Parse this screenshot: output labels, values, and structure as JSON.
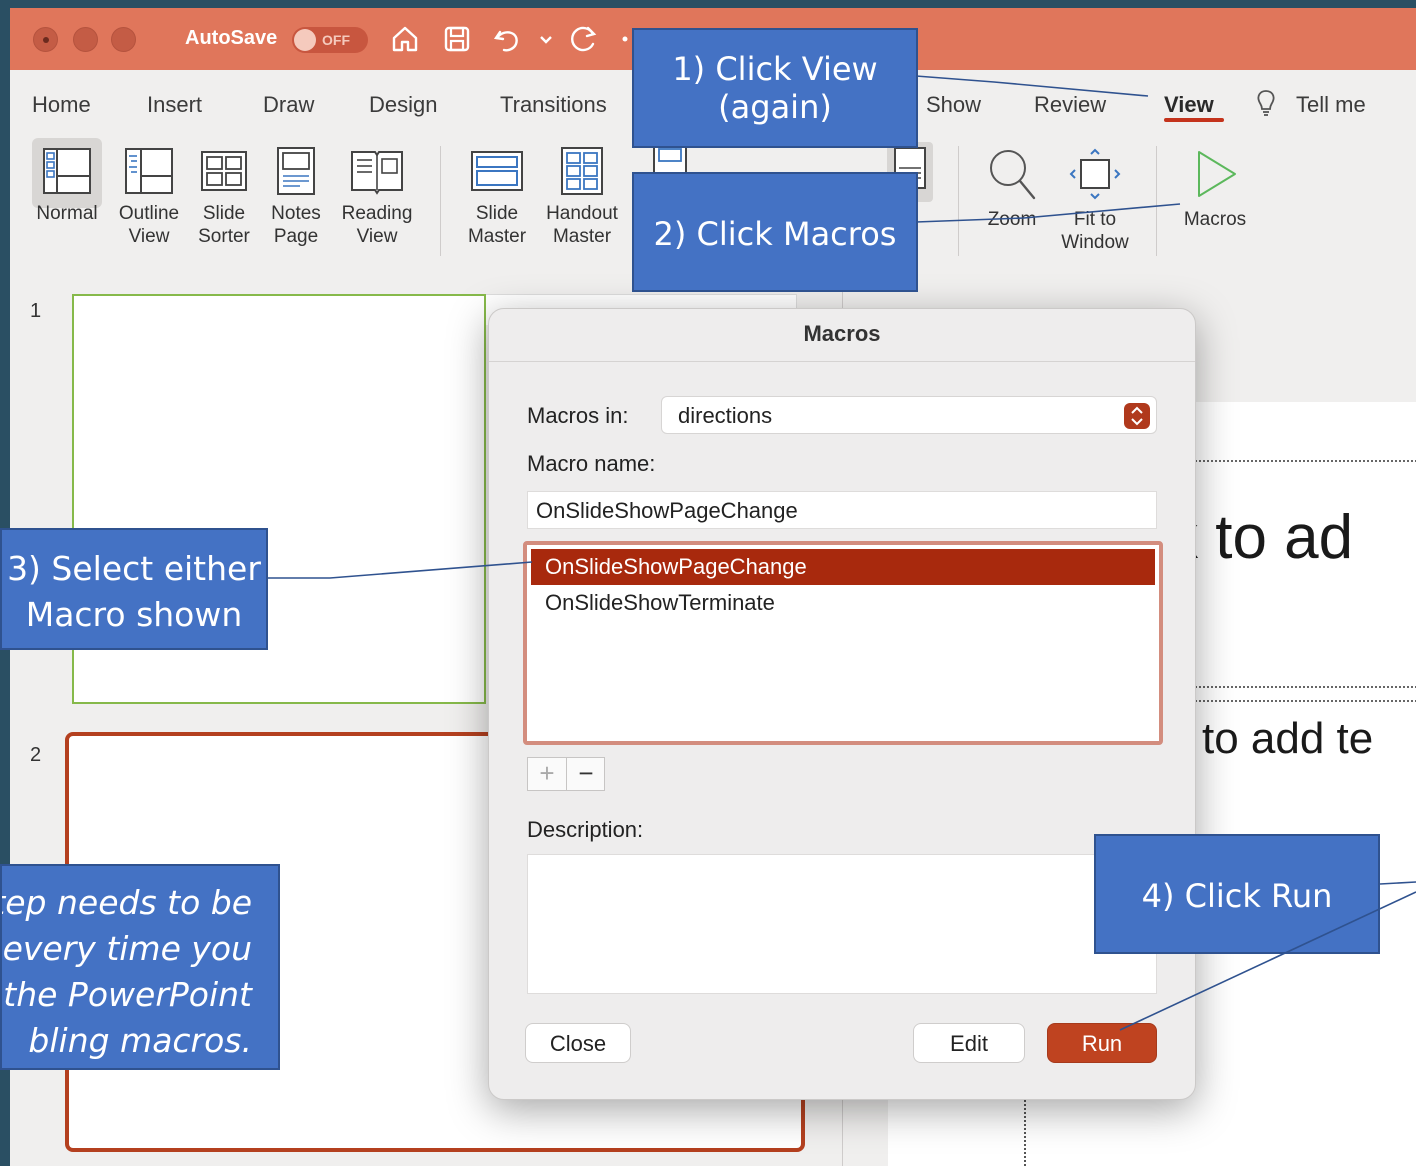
{
  "titlebar": {
    "autosave_label": "AutoSave",
    "autosave_state": "OFF",
    "icons": [
      "home-icon",
      "save-icon",
      "undo-icon",
      "redo-icon"
    ]
  },
  "tabs": [
    "Home",
    "Insert",
    "Draw",
    "Design",
    "Transitions",
    "Show",
    "Review",
    "View",
    "Tell me"
  ],
  "active_tab": "View",
  "toolbar": {
    "normal": "Normal",
    "outline": "Outline\nView",
    "slide_sorter": "Slide\nSorter",
    "notes_page": "Notes\nPage",
    "reading_view": "Reading\nView",
    "slide_master": "Slide\nMaster",
    "handout_master": "Handout\nMaster",
    "zoom": "Zoom",
    "fit_to_window": "Fit to\nWindow",
    "macros": "Macros"
  },
  "slides": {
    "numbers": [
      "1",
      "2"
    ]
  },
  "editor": {
    "title_fragment": "k to ad",
    "subtitle_fragment": "to add te"
  },
  "dialog": {
    "title": "Macros",
    "macros_in_label": "Macros in:",
    "macros_in_value": "directions",
    "macro_name_label": "Macro name:",
    "macro_name_value": "OnSlideShowPageChange",
    "macro_list": [
      "OnSlideShowPageChange",
      "OnSlideShowTerminate"
    ],
    "selected_macro": "OnSlideShowPageChange",
    "add_label": "+",
    "remove_label": "−",
    "description_label": "Description:",
    "close_label": "Close",
    "edit_label": "Edit",
    "run_label": "Run"
  },
  "callouts": {
    "step1": "1) Click View (again)",
    "step2": "2) Click Macros",
    "step3": "3) Select either Macro shown",
    "step4": "4) Click Run",
    "note": "tep needs to be\nevery time you\n the PowerPoint\nbling macros."
  },
  "colors": {
    "titlebar": "#e0765b",
    "accent": "#bf4320",
    "selection": "#a8290d",
    "callout": "#4472c4"
  }
}
